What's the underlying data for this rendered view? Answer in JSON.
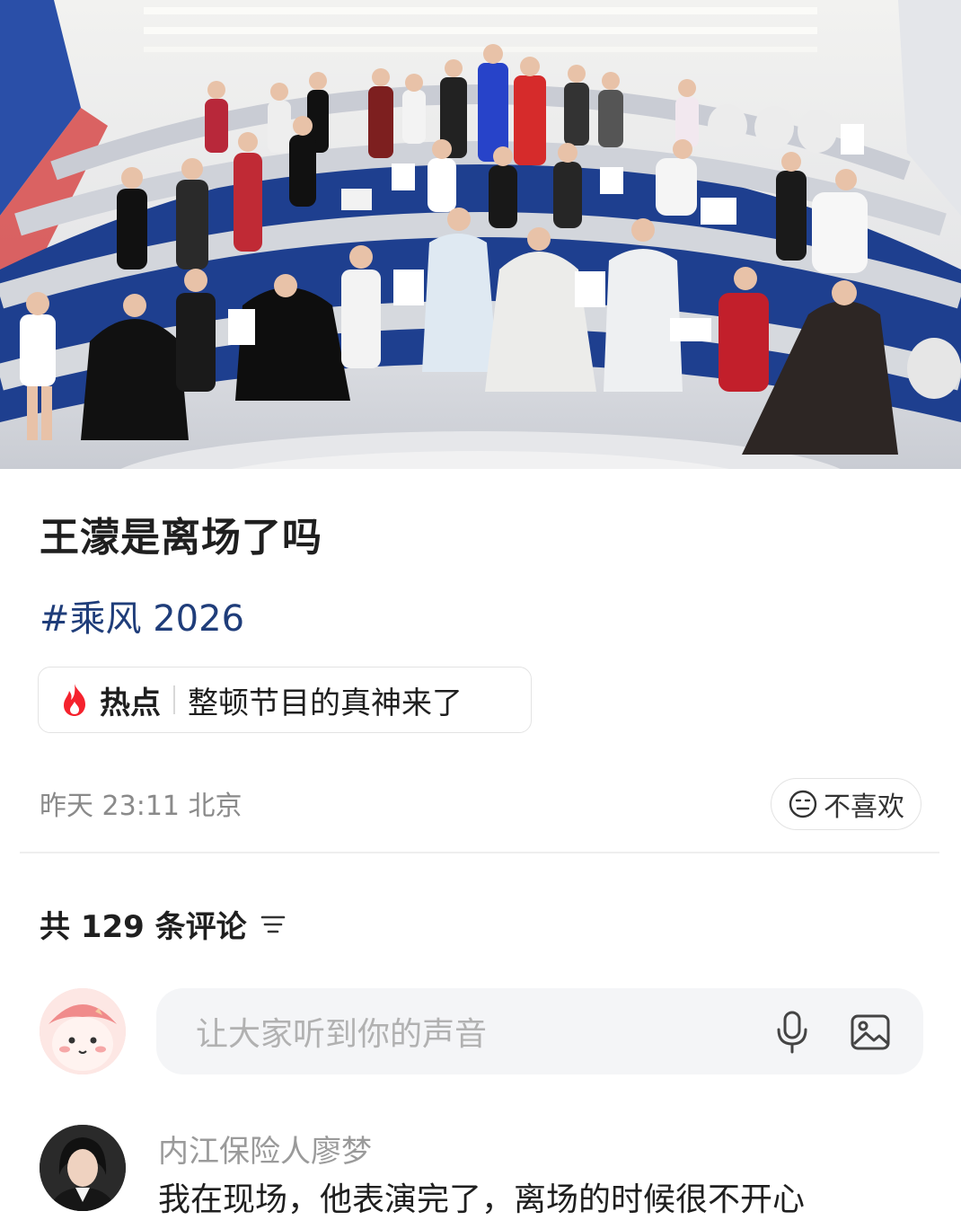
{
  "post": {
    "title": "王濛是离场了吗",
    "hashtag": "#乘风 2026",
    "hot": {
      "label": "热点",
      "text": "整顿节目的真神来了",
      "icon": "flame-icon",
      "icon_color": "#f5222d"
    },
    "meta": "昨天 23:11 北京",
    "dislike_label": "不喜欢"
  },
  "comments": {
    "count_text": "共 129 条评论",
    "input_placeholder": "让大家听到你的声音",
    "first": {
      "username": "内江保险人廖梦",
      "text": "我在现场，他表演完了，离场的时候很不开心"
    }
  },
  "colors": {
    "hashtag": "#1f3d7a",
    "stage_blue": "#1e3f8f",
    "placeholder": "#b1b1b1"
  }
}
